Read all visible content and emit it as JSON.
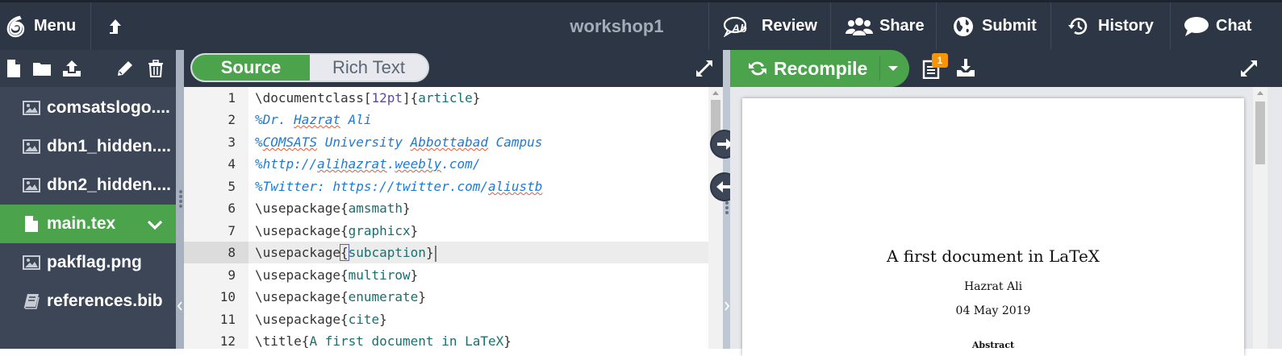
{
  "topbar": {
    "menu_label": "Menu",
    "project_title": "workshop1",
    "review_label": "Review",
    "share_label": "Share",
    "submit_label": "Submit",
    "history_label": "History",
    "chat_label": "Chat"
  },
  "filetree": {
    "items": [
      {
        "name": "comsatslogo....",
        "icon": "image-icon"
      },
      {
        "name": "dbn1_hidden....",
        "icon": "image-icon"
      },
      {
        "name": "dbn2_hidden....",
        "icon": "image-icon"
      },
      {
        "name": "main.tex",
        "icon": "file-icon",
        "selected": true
      },
      {
        "name": "pakflag.png",
        "icon": "image-icon"
      },
      {
        "name": "references.bib",
        "icon": "book-icon"
      }
    ]
  },
  "editor": {
    "mode_source": "Source",
    "mode_rich_text": "Rich Text",
    "active_mode": "Source",
    "active_line": 8,
    "line_numbers": [
      "1",
      "2",
      "3",
      "4",
      "5",
      "6",
      "7",
      "8",
      "9",
      "10",
      "11",
      "12"
    ],
    "lines": [
      "\\documentclass[12pt]{article}",
      "%Dr. Hazrat Ali",
      "%COMSATS University Abbottabad Campus",
      "%http://alihazrat.weebly.com/",
      "%Twitter: https://twitter.com/aliustb",
      "\\usepackage{amsmath}",
      "\\usepackage{graphicx}",
      "\\usepackage{subcaption}",
      "\\usepackage{multirow}",
      "\\usepackage{enumerate}",
      "\\usepackage{cite}",
      "\\title{A first document in LaTeX}"
    ]
  },
  "pdf": {
    "recompile_label": "Recompile",
    "log_badge": "1",
    "doc_title": "A first document in LaTeX",
    "doc_author": "Hazrat Ali",
    "doc_date": "04 May 2019",
    "doc_abstract_heading": "Abstract"
  },
  "colors": {
    "topbar_bg": "#2c3645",
    "sidebar_bg": "#3c4656",
    "accent_green": "#4ba34c",
    "badge_orange": "#f89406"
  }
}
